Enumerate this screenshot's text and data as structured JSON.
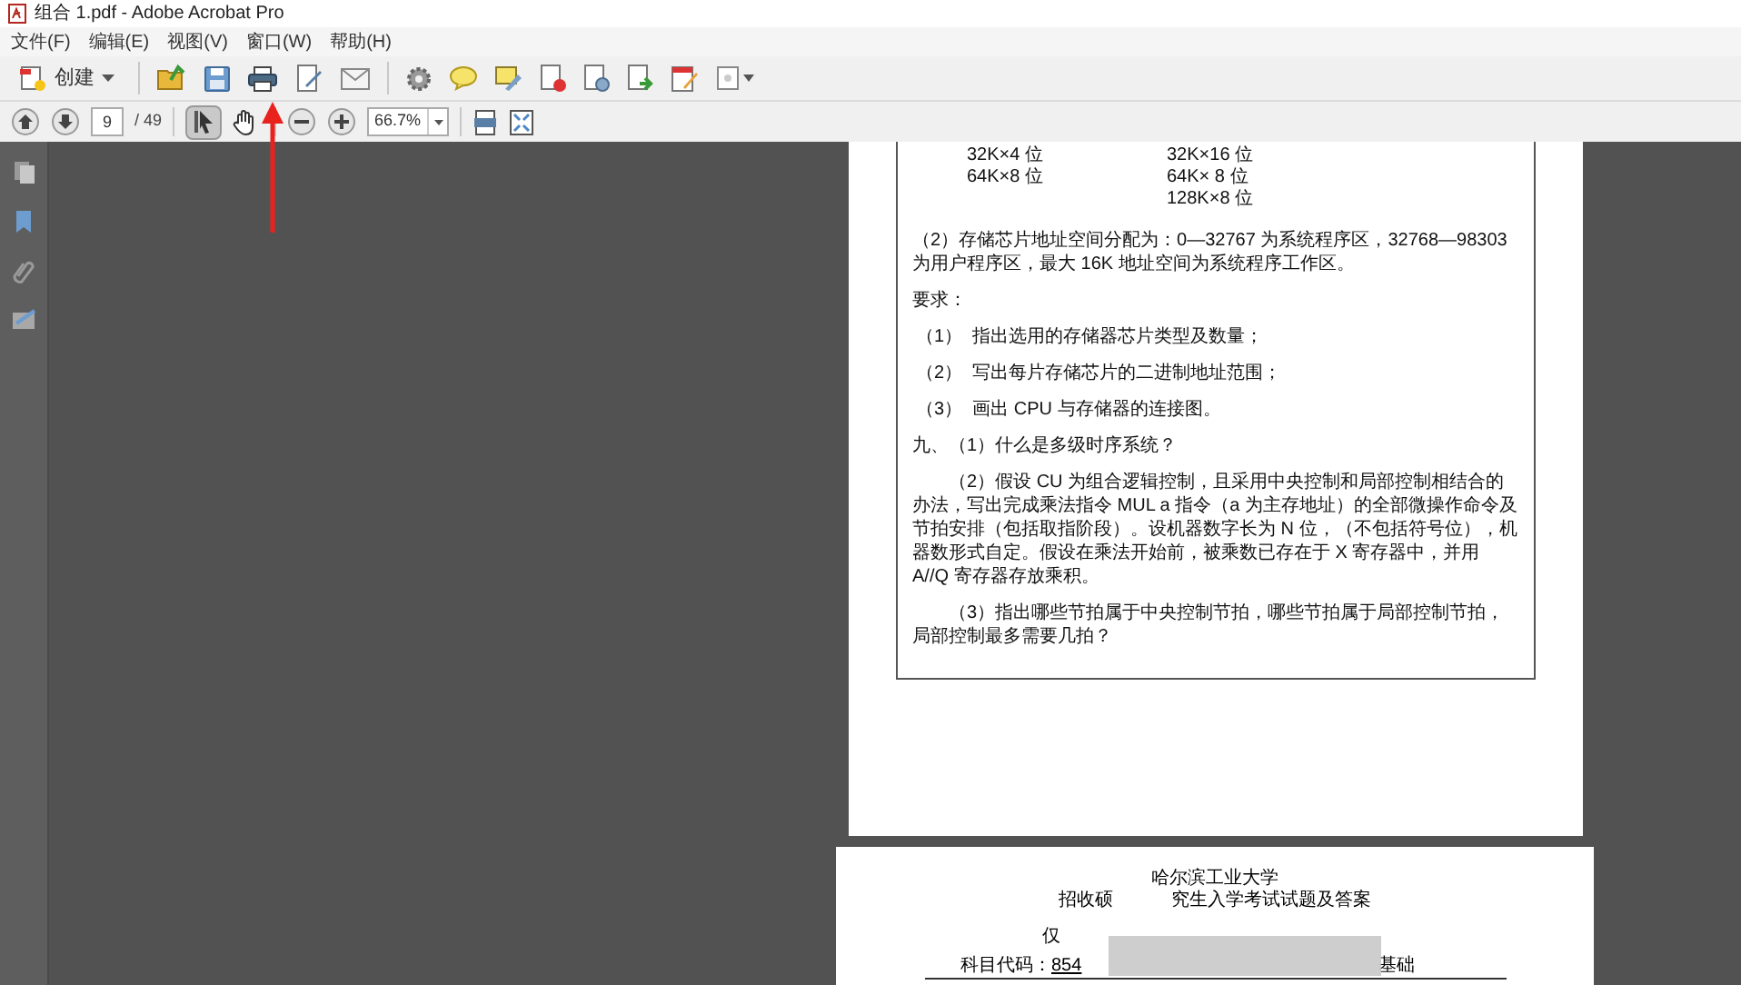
{
  "window": {
    "title": "组合 1.pdf - Adobe Acrobat Pro"
  },
  "menu": [
    {
      "label": "文件(F)"
    },
    {
      "label": "编辑(E)"
    },
    {
      "label": "视图(V)"
    },
    {
      "label": "窗口(W)"
    },
    {
      "label": "帮助(H)"
    }
  ],
  "toolbar": {
    "create_label": "创建",
    "page_number": "9",
    "page_total": "/ 49",
    "zoom": "66.7%"
  },
  "tools": [
    {
      "kind": "select",
      "selected": true
    },
    {
      "kind": "hand",
      "selected": false
    }
  ],
  "page_1": {
    "table_columns": [
      [
        "32K×4 位",
        "64K×8 位"
      ],
      [
        "32K×16 位",
        "64K× 8 位",
        "128K×8 位"
      ]
    ],
    "blocks": [
      {
        "kind": "para",
        "text": "（2）存储芯片地址空间分配为：0—32767 为系统程序区，32768—98303 为用户程序区，最大 16K 地址空间为系统程序工作区。"
      },
      {
        "kind": "para",
        "text": "要求："
      },
      {
        "kind": "item",
        "text": "（1）  指出选用的存储器芯片类型及数量；"
      },
      {
        "kind": "item",
        "text": "（2）  写出每片存储芯片的二进制地址范围；"
      },
      {
        "kind": "item",
        "text": "（3）  画出 CPU 与存储器的连接图。"
      },
      {
        "kind": "para",
        "text": "九、（1）什么是多级时序系统？"
      },
      {
        "kind": "indented",
        "text": "（2）假设 CU 为组合逻辑控制，且采用中央控制和局部控制相结合的办法，写出完成乘法指令 MUL a 指令（a 为主存地址）的全部微操作命令及节拍安排（包括取指阶段）。设机器数字长为 N 位，（不包括符号位），机器数形式自定。假设在乘法开始前，被乘数已存在于 X 寄存器中，并用 A//Q 寄存器存放乘积。"
      },
      {
        "kind": "indented",
        "text": "（3）指出哪些节拍属于中央控制节拍，哪些节拍属于局部控制节拍，局部控制最多需要几拍？"
      }
    ]
  },
  "page_2": {
    "university": "哈尔滨工业大学",
    "title_left": "招收硕",
    "title_right": "究生入学考试试题及答案",
    "line_3": "仅",
    "code_label": "科目代码：",
    "code": "854",
    "subject_tail": "基础"
  }
}
